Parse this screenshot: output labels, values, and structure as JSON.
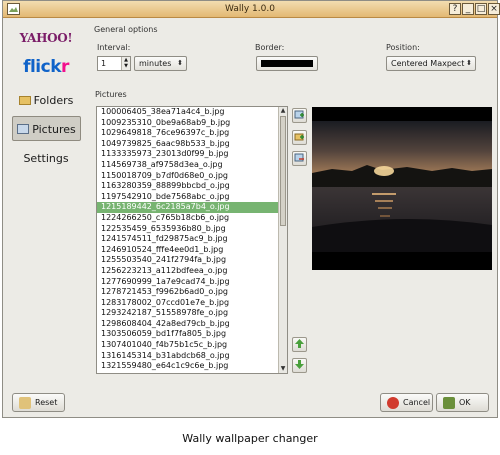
{
  "window": {
    "title": "Wally 1.0.0",
    "controls": [
      "?",
      "_",
      "□",
      "×"
    ]
  },
  "sidebar": {
    "items": [
      {
        "label": "YAHOO!",
        "icon": "yahoo-logo"
      },
      {
        "label": "flickr",
        "icon": "flickr-logo"
      },
      {
        "label": "Folders",
        "icon": "folder-icon"
      },
      {
        "label": "Pictures",
        "icon": "pictures-icon"
      },
      {
        "label": "Settings",
        "icon": ""
      }
    ]
  },
  "general_options": {
    "heading": "General options",
    "interval_label": "Interval:",
    "interval_value": "1",
    "interval_unit": "minutes",
    "border_label": "Border:",
    "border_color": "#000000",
    "position_label": "Position:",
    "position_value": "Centered Maxpect"
  },
  "pictures": {
    "heading": "Pictures",
    "files": [
      "100006405_38ea71a4c4_b.jpg",
      "1009235310_0be9a68ab9_b.jpg",
      "1029649818_76ce96397c_b.jpg",
      "1049739825_6aac98b533_b.jpg",
      "1133335973_23013d0f99_b.jpg",
      "114569738_af9758d3ea_o.jpg",
      "1150018709_b7df0d68e0_o.jpg",
      "1163280359_88899bbcbd_o.jpg",
      "1197542910_bde7568abc_o.jpg",
      "1215189442_6c2185a7b4_o.jpg",
      "1224266250_c765b18cb6_o.jpg",
      "122535459_6535936b80_b.jpg",
      "1241574511_fd29875ac9_b.jpg",
      "1246910524_fffe4ee0d1_b.jpg",
      "1255503540_241f2794fa_b.jpg",
      "1256223213_a112bdfeea_o.jpg",
      "1277690999_1a7e9cad74_b.jpg",
      "1278721453_f9962b6ad0_o.jpg",
      "1283178002_07ccd01e7e_b.jpg",
      "1293242187_51558978fe_o.jpg",
      "1298608404_42a8ed79cb_b.jpg",
      "1303506059_bd1f7fa805_b.jpg",
      "1307401040_f4b75b1c5c_b.jpg",
      "1316145314_b31abdcb68_o.jpg",
      "1321559480_e64c1c9c6e_b.jpg"
    ],
    "selected_index": 9
  },
  "buttons": {
    "reset": "Reset",
    "cancel": "Cancel",
    "ok": "OK"
  },
  "caption": "Wally wallpaper changer",
  "colors": {
    "selection": "#77b471",
    "titlebar": "#e3b873"
  }
}
